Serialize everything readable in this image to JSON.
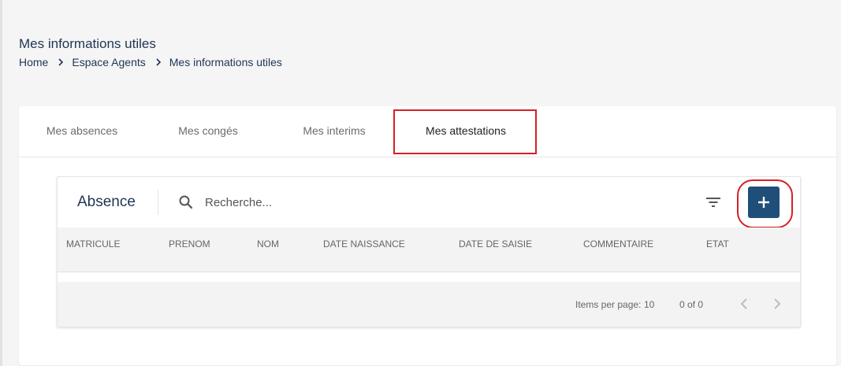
{
  "page": {
    "title": "Mes informations utiles",
    "breadcrumb": [
      "Home",
      "Espace Agents",
      "Mes informations utiles"
    ]
  },
  "tabs": [
    {
      "label": "Mes absences",
      "active": false
    },
    {
      "label": "Mes congés",
      "active": false
    },
    {
      "label": "Mes interims",
      "active": false
    },
    {
      "label": "Mes attestations",
      "active": true
    }
  ],
  "table": {
    "title": "Absence",
    "search_placeholder": "Recherche...",
    "add_label": "+",
    "columns": [
      "MATRICULE",
      "PRENOM",
      "NOM",
      "DATE NAISSANCE",
      "DATE DE SAISIE",
      "COMMENTAIRE",
      "ETAT"
    ],
    "rows": []
  },
  "paginator": {
    "items_per_page_label": "Items per page:",
    "items_per_page": "10",
    "range": "0 of 0"
  },
  "colors": {
    "accent": "#1f4e79",
    "title": "#1f3553",
    "highlight": "#d71f26"
  },
  "icons": [
    "chevron-right-icon",
    "search-icon",
    "filter-icon",
    "plus-icon",
    "chevron-left-icon"
  ]
}
